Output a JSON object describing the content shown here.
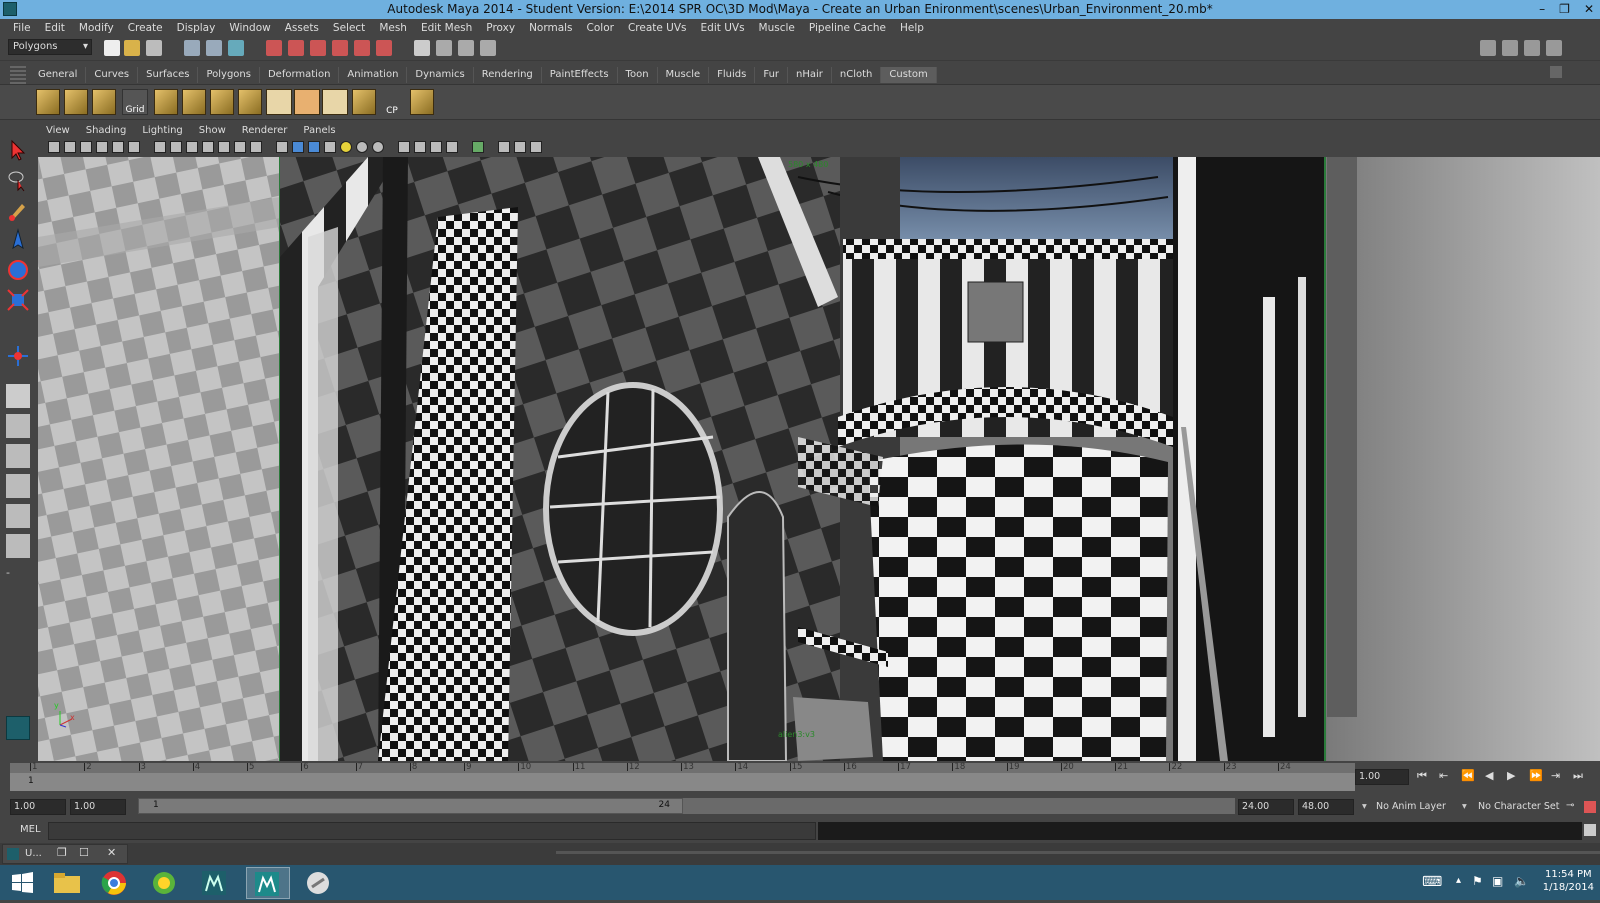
{
  "window": {
    "title": "Autodesk Maya 2014 - Student Version: E:\\2014 SPR OC\\3D Mod\\Maya - Create an Urban Enironment\\scenes\\Urban_Environment_20.mb*",
    "controls": [
      "–",
      "❐",
      "✕"
    ]
  },
  "menu": [
    "File",
    "Edit",
    "Modify",
    "Create",
    "Display",
    "Window",
    "Assets",
    "Select",
    "Mesh",
    "Edit Mesh",
    "Proxy",
    "Normals",
    "Color",
    "Create UVs",
    "Edit UVs",
    "Muscle",
    "Pipeline Cache",
    "Help"
  ],
  "statusline": {
    "mode": "Polygons"
  },
  "shelf": {
    "tabs": [
      "General",
      "Curves",
      "Surfaces",
      "Polygons",
      "Deformation",
      "Animation",
      "Dynamics",
      "Rendering",
      "PaintEffects",
      "Toon",
      "Muscle",
      "Fluids",
      "Fur",
      "nHair",
      "nCloth",
      "Custom"
    ],
    "active_tab": "Custom",
    "labels": {
      "grid": "Grid",
      "cp": "CP"
    }
  },
  "panel_menu": [
    "View",
    "Shading",
    "Lighting",
    "Show",
    "Renderer",
    "Panels"
  ],
  "viewport": {
    "hud_top": "580 x 480",
    "hud_bottom": "alien3:v3",
    "axis_y": "y",
    "axis_x": "x"
  },
  "timeline": {
    "ticks": [
      "1",
      "2",
      "3",
      "4",
      "5",
      "6",
      "7",
      "8",
      "9",
      "10",
      "11",
      "12",
      "13",
      "14",
      "15",
      "16",
      "17",
      "18",
      "19",
      "20",
      "21",
      "22",
      "23",
      "24"
    ],
    "current_frame": "1",
    "current_time_field": "1.00"
  },
  "range": {
    "start_time": "1.00",
    "playback_start": "1.00",
    "range_start_label": "1",
    "range_end_label": "24",
    "playback_end": "24.00",
    "end_time": "48.00",
    "anim_layer": "No Anim Layer",
    "character_set": "No Character Set"
  },
  "command": {
    "label": "MEL"
  },
  "minimized": {
    "label": "U..."
  },
  "taskbar": {
    "time": "11:54 PM",
    "date": "1/18/2014"
  }
}
